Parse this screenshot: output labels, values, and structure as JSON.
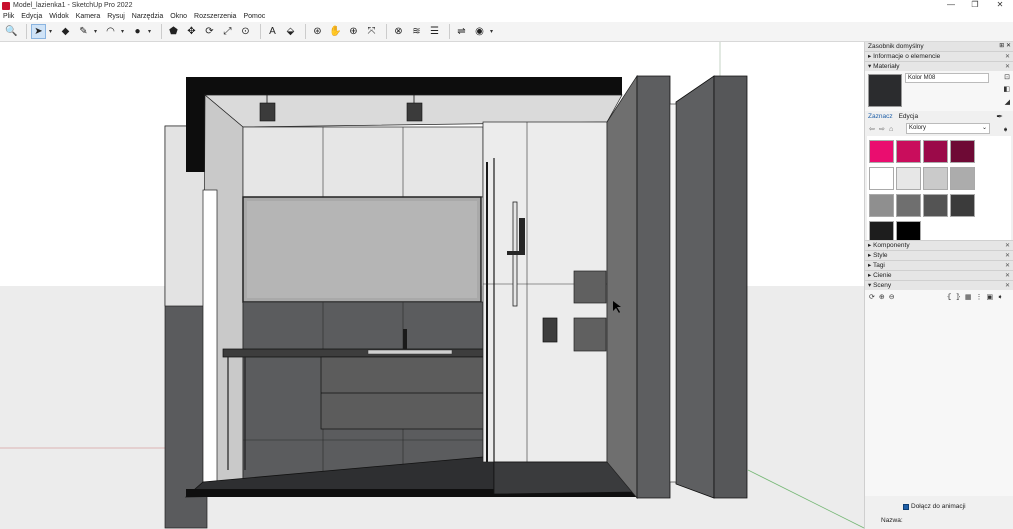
{
  "window": {
    "title": "Model_lazienka1 - SketchUp Pro 2022",
    "min": "—",
    "max": "❐",
    "close": "✕"
  },
  "menu": [
    "Plik",
    "Edycja",
    "Widok",
    "Kamera",
    "Rysuj",
    "Narzędzia",
    "Okno",
    "Rozszerzenia",
    "Pomoc"
  ],
  "toolbar": {
    "tools": [
      {
        "name": "search-icon",
        "glyph": "🔍"
      },
      {
        "name": "select-tool-icon",
        "glyph": "➤"
      },
      {
        "name": "eraser-icon",
        "glyph": "◆"
      },
      {
        "name": "pencil-icon",
        "glyph": "✎"
      },
      {
        "name": "arc-icon",
        "glyph": "◠"
      },
      {
        "name": "circle-shape-icon",
        "glyph": "●"
      },
      {
        "name": "push-pull-icon",
        "glyph": "⬟"
      },
      {
        "name": "move-icon",
        "glyph": "✥"
      },
      {
        "name": "rotate-icon",
        "glyph": "⟳"
      },
      {
        "name": "scale-icon",
        "glyph": "⤢"
      },
      {
        "name": "tape-measure-icon",
        "glyph": "⊙"
      },
      {
        "name": "text-icon",
        "glyph": "A"
      },
      {
        "name": "paint-bucket-icon",
        "glyph": "⬙"
      },
      {
        "name": "orbit-icon",
        "glyph": "⊛"
      },
      {
        "name": "pan-icon",
        "glyph": "✋"
      },
      {
        "name": "zoom-icon",
        "glyph": "⊕"
      },
      {
        "name": "zoom-extents-icon",
        "glyph": "⤧"
      },
      {
        "name": "warehouse-icon",
        "glyph": "⊗"
      },
      {
        "name": "extension-warehouse-icon",
        "glyph": "≋"
      },
      {
        "name": "layers-icon",
        "glyph": "☰"
      },
      {
        "name": "trimble-connect-icon",
        "glyph": "⇌"
      },
      {
        "name": "account-icon",
        "glyph": "◉"
      }
    ]
  },
  "tray": {
    "title": "Zasobnik domyślny",
    "entity_info": "Informacje o elemencie",
    "materials": "Materiały",
    "material_name": "Kolor M08",
    "tab_select": "Zaznacz",
    "tab_edit": "Edycja",
    "library": "Kolory",
    "panels": [
      "Komponenty",
      "Style",
      "Tagi",
      "Cienie",
      "Sceny"
    ],
    "add_to_animation": "Dołącz do animacji",
    "name_label": "Nazwa:"
  },
  "swatches": [
    "#ea0d6f",
    "#c90d5c",
    "#9b0a49",
    "#6e0a35",
    "#ffffff",
    "#e7e7e7",
    "#cacaca",
    "#acacac",
    "#8f8f8f",
    "#6f6f6f",
    "#545454",
    "#3b3b3b",
    "#1d1d1d",
    "#000000"
  ]
}
